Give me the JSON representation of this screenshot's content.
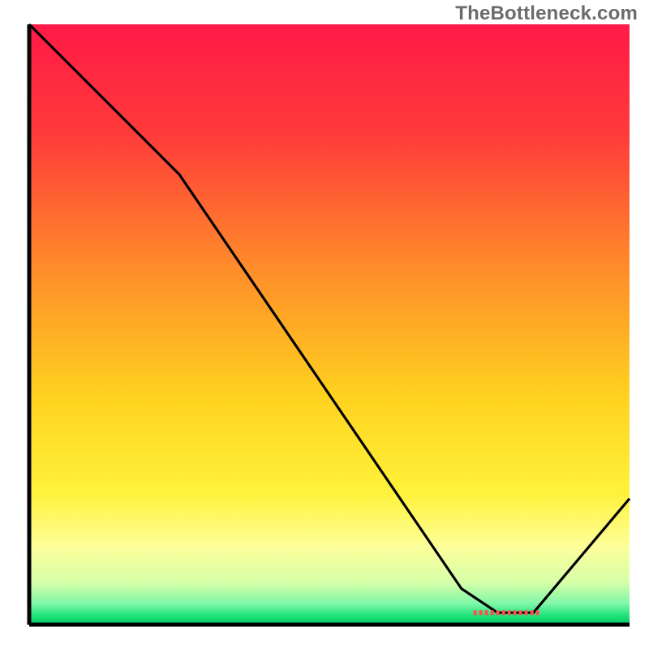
{
  "watermark": "TheBottleneck.com",
  "chart_data": {
    "type": "line",
    "title": "",
    "xlabel": "",
    "ylabel": "",
    "xlim": [
      0,
      100
    ],
    "ylim": [
      0,
      100
    ],
    "grid": false,
    "series": [
      {
        "name": "bottleneck-curve",
        "x": [
          0,
          25,
          72,
          78,
          84,
          100
        ],
        "values": [
          100,
          75,
          6,
          2,
          2,
          21
        ]
      }
    ],
    "annotations": [
      {
        "name": "min-zone-marker",
        "x_start": 74,
        "x_end": 85,
        "y": 2
      }
    ],
    "background_gradient": [
      {
        "pos": 0.0,
        "color": "#ff1a47"
      },
      {
        "pos": 0.18,
        "color": "#ff3a3a"
      },
      {
        "pos": 0.4,
        "color": "#ff8a2a"
      },
      {
        "pos": 0.62,
        "color": "#ffd21f"
      },
      {
        "pos": 0.78,
        "color": "#fff23a"
      },
      {
        "pos": 0.87,
        "color": "#fdff9a"
      },
      {
        "pos": 0.93,
        "color": "#d6ffa8"
      },
      {
        "pos": 0.965,
        "color": "#7ff7a8"
      },
      {
        "pos": 0.985,
        "color": "#1fe27a"
      },
      {
        "pos": 1.0,
        "color": "#06c563"
      }
    ],
    "axes_color": "#000000",
    "curve_color": "#000000",
    "marker_color": "#ff4f4f"
  }
}
